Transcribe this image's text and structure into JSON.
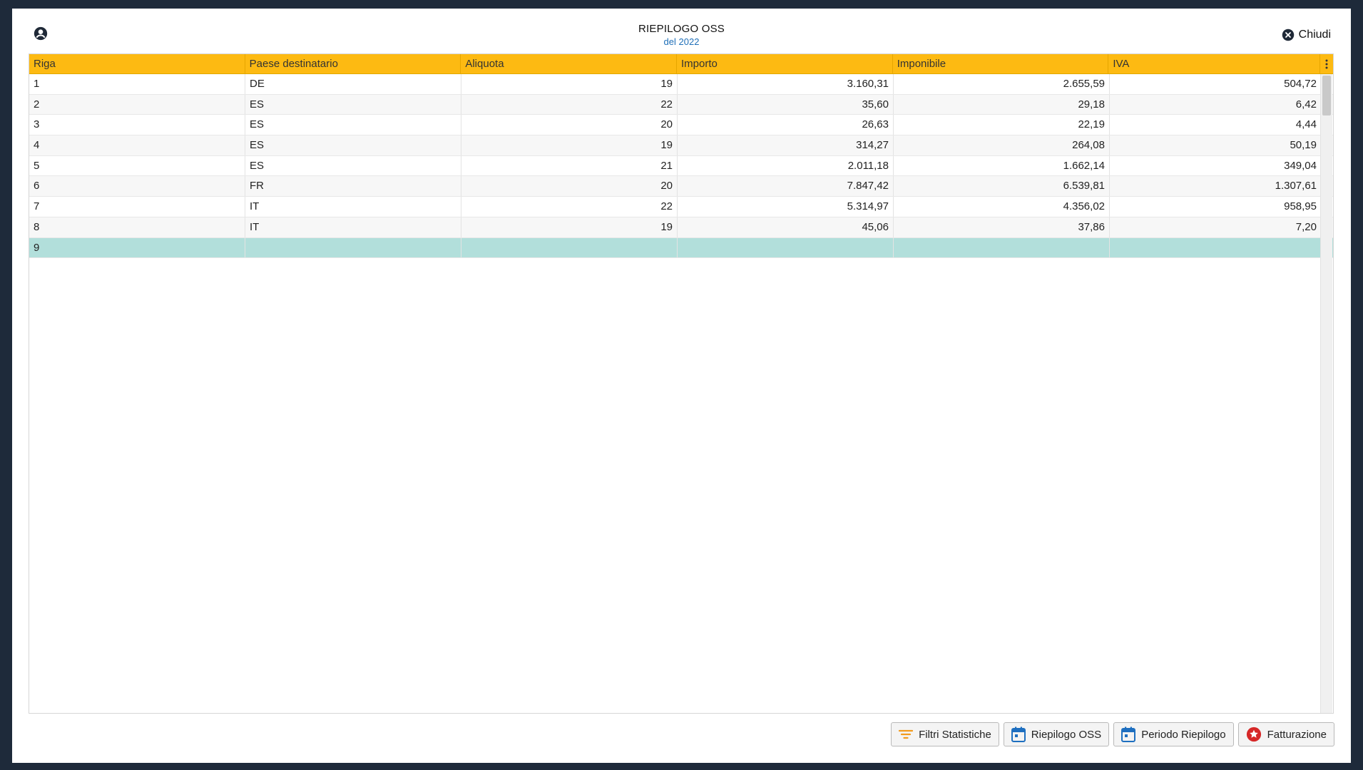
{
  "header": {
    "title": "RIEPILOGO OSS",
    "subtitle": "del 2022",
    "close_label": "Chiudi"
  },
  "columns": [
    "Riga",
    "Paese destinatario",
    "Aliquota",
    "Importo",
    "Imponibile",
    "IVA"
  ],
  "rows": [
    {
      "riga": "1",
      "paese": "DE",
      "aliquota": "19",
      "importo": "3.160,31",
      "imponibile": "2.655,59",
      "iva": "504,72"
    },
    {
      "riga": "2",
      "paese": "ES",
      "aliquota": "22",
      "importo": "35,60",
      "imponibile": "29,18",
      "iva": "6,42"
    },
    {
      "riga": "3",
      "paese": "ES",
      "aliquota": "20",
      "importo": "26,63",
      "imponibile": "22,19",
      "iva": "4,44"
    },
    {
      "riga": "4",
      "paese": "ES",
      "aliquota": "19",
      "importo": "314,27",
      "imponibile": "264,08",
      "iva": "50,19"
    },
    {
      "riga": "5",
      "paese": "ES",
      "aliquota": "21",
      "importo": "2.011,18",
      "imponibile": "1.662,14",
      "iva": "349,04"
    },
    {
      "riga": "6",
      "paese": "FR",
      "aliquota": "20",
      "importo": "7.847,42",
      "imponibile": "6.539,81",
      "iva": "1.307,61"
    },
    {
      "riga": "7",
      "paese": "IT",
      "aliquota": "22",
      "importo": "5.314,97",
      "imponibile": "4.356,02",
      "iva": "958,95"
    },
    {
      "riga": "8",
      "paese": "IT",
      "aliquota": "19",
      "importo": "45,06",
      "imponibile": "37,86",
      "iva": "7,20"
    },
    {
      "riga": "9",
      "paese": "",
      "aliquota": "",
      "importo": "",
      "imponibile": "",
      "iva": ""
    }
  ],
  "selected_row": "9",
  "toolbar": {
    "filtri_label": "Filtri Statistiche",
    "riepilogo_label": "Riepilogo OSS",
    "periodo_label": "Periodo Riepilogo",
    "fatturazione_label": "Fatturazione"
  },
  "colors": {
    "header_bg": "#fdba12",
    "selected_row": "#b2dfdb",
    "subtitle": "#1f6fb8",
    "calendar_icon": "#1e6fc0",
    "filter_icon": "#f29b1d",
    "fatturazione_icon": "#d62828"
  },
  "icons": {
    "user": "user-circle-icon",
    "close": "close-circle-icon",
    "column_menu": "dots-vertical-icon",
    "filtri": "filter-icon",
    "riepilogo": "calendar-icon",
    "periodo": "calendar-icon",
    "fatturazione": "star-badge-icon"
  }
}
